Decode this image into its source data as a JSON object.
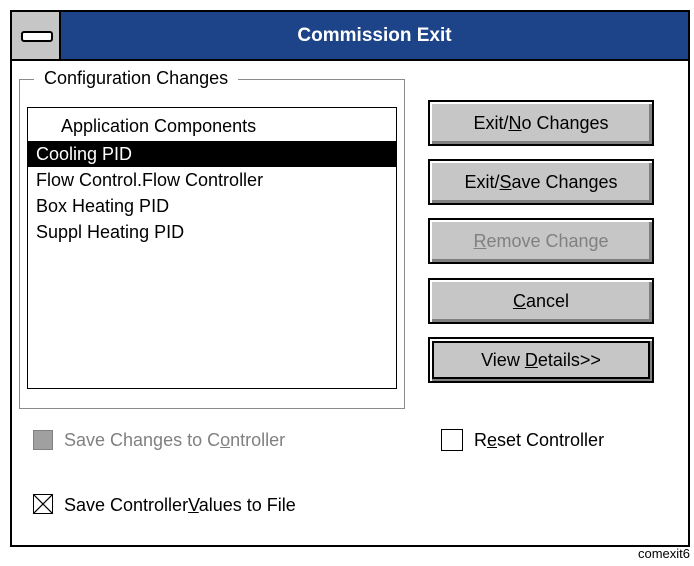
{
  "window": {
    "title": "Commission Exit"
  },
  "group": {
    "legend": "Configuration Changes"
  },
  "list": {
    "header": "Application Components",
    "items": [
      "Cooling PID",
      "Flow Control.Flow Controller",
      "Box Heating PID",
      "Suppl Heating PID"
    ],
    "selected_index": 0
  },
  "buttons": {
    "exit_no_changes": {
      "pre": "Exit/",
      "mn": "N",
      "post": "o Changes"
    },
    "exit_save_changes": {
      "pre": "Exit/",
      "mn": "S",
      "post": "ave Changes"
    },
    "remove_change": {
      "pre": "",
      "mn": "R",
      "post": "emove Change"
    },
    "cancel": {
      "pre": "",
      "mn": "C",
      "post": "ancel"
    },
    "view_details": {
      "pre": "View ",
      "mn": "D",
      "post": "etails>>"
    }
  },
  "checkboxes": {
    "save_to_controller": {
      "pre": "Save Changes to C",
      "mn": "o",
      "post": "ntroller",
      "checked": false,
      "enabled": false
    },
    "reset_controller": {
      "pre": "R",
      "mn": "e",
      "post": "set Controller",
      "checked": false,
      "enabled": true
    },
    "save_values_to_file": {
      "pre": "Save Controller",
      "mn": "V",
      "post": "alues to File",
      "checked": true,
      "enabled": true
    }
  },
  "caption": "comexit6"
}
